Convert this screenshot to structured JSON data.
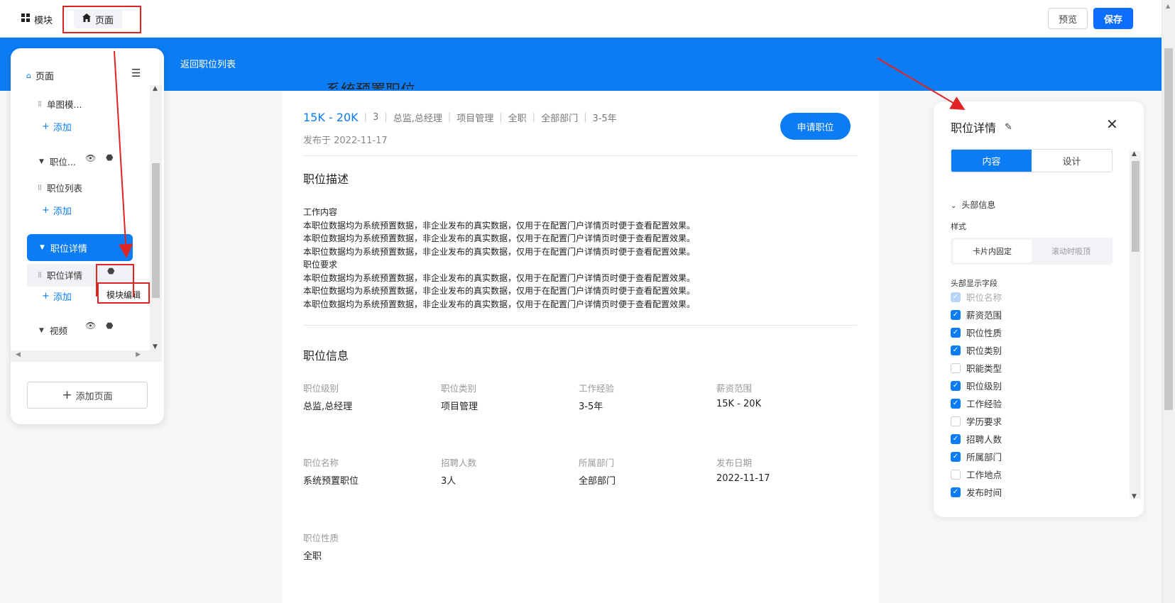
{
  "topbar": {
    "tab_blocks": "模块",
    "tab_page": "页面",
    "preview_label": "预览",
    "save_label": "保存"
  },
  "banner": {
    "back_label": "返回职位列表"
  },
  "job": {
    "title": "系统预置职位",
    "salary": "15K - 20K",
    "meta": [
      "3",
      "总监,总经理",
      "项目管理",
      "全职",
      "全部部门",
      "3-5年"
    ],
    "published": "发布于 2022-11-17",
    "apply_label": "申请职位",
    "desc_title": "职位描述",
    "desc_lines": [
      "工作内容",
      "本职位数据均为系统预置数据，非企业发布的真实数据，仅用于在配置门户详情页时便于查看配置效果。",
      "本职位数据均为系统预置数据，非企业发布的真实数据，仅用于在配置门户详情页时便于查看配置效果。",
      "本职位数据均为系统预置数据，非企业发布的真实数据，仅用于在配置门户详情页时便于查看配置效果。",
      "职位要求",
      "本职位数据均为系统预置数据，非企业发布的真实数据，仅用于在配置门户详情页时便于查看配置效果。",
      "本职位数据均为系统预置数据，非企业发布的真实数据，仅用于在配置门户详情页时便于查看配置效果。",
      "本职位数据均为系统预置数据，非企业发布的真实数据，仅用于在配置门户详情页时便于查看配置效果。"
    ],
    "info_title": "职位信息",
    "info": [
      {
        "label": "职位级别",
        "value": "总监,总经理"
      },
      {
        "label": "职位类别",
        "value": "项目管理"
      },
      {
        "label": "工作经验",
        "value": "3-5年"
      },
      {
        "label": "薪资范围",
        "value": "15K - 20K"
      },
      {
        "label": "职位名称",
        "value": "系统预置职位"
      },
      {
        "label": "招聘人数",
        "value": "3人"
      },
      {
        "label": "所属部门",
        "value": "全部部门"
      },
      {
        "label": "发布日期",
        "value": "2022-11-17"
      },
      {
        "label": "职位性质",
        "value": "全职"
      }
    ]
  },
  "left_panel": {
    "header": "页面",
    "items": {
      "single_image": "单图模...",
      "add": "添加",
      "job_group": "职位...",
      "job_list": "职位列表",
      "job_detail_group": "职位详情",
      "job_detail": "职位详情",
      "video": "视频"
    },
    "tooltip": "模块编辑",
    "add_page": "添加页面"
  },
  "right_panel": {
    "title": "职位详情",
    "tab_content": "内容",
    "tab_design": "设计",
    "group_header": "头部信息",
    "style_label": "样式",
    "style_fixed": "卡片内固定",
    "style_sticky": "滚动时吸顶",
    "fields_label": "头部显示字段",
    "fields": [
      {
        "label": "职位名称",
        "state": "disabled"
      },
      {
        "label": "薪资范围",
        "state": "checked"
      },
      {
        "label": "职位性质",
        "state": "checked"
      },
      {
        "label": "职位类别",
        "state": "checked"
      },
      {
        "label": "职能类型",
        "state": "unchecked"
      },
      {
        "label": "职位级别",
        "state": "checked"
      },
      {
        "label": "工作经验",
        "state": "checked"
      },
      {
        "label": "学历要求",
        "state": "unchecked"
      },
      {
        "label": "招聘人数",
        "state": "checked"
      },
      {
        "label": "所属部门",
        "state": "checked"
      },
      {
        "label": "工作地点",
        "state": "unchecked"
      },
      {
        "label": "发布时间",
        "state": "checked"
      }
    ]
  },
  "colors": {
    "primary": "#0c7cf4",
    "annotation_red": "#e02424"
  }
}
